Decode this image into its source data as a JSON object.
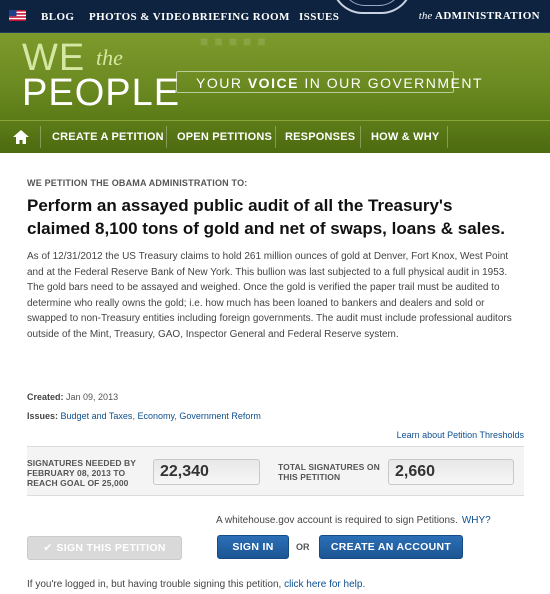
{
  "topnav": {
    "links": [
      "BLOG",
      "PHOTOS & VIDEO",
      "BRIEFING ROOM",
      "ISSUES"
    ],
    "admin_prefix": "the",
    "admin_label": "ADMINISTRATION"
  },
  "banner": {
    "logo_we": "WE",
    "logo_the": "the",
    "logo_people": "PEOPLE",
    "tagline_pre": "YOUR",
    "tagline_bold": "VOICE",
    "tagline_post": "IN OUR GOVERNMENT"
  },
  "subnav": {
    "items": [
      "CREATE A PETITION",
      "OPEN PETITIONS",
      "RESPONSES",
      "HOW & WHY"
    ]
  },
  "petition": {
    "kicker": "WE PETITION THE OBAMA ADMINISTRATION TO:",
    "title": "Perform an assayed public audit of all the Treasury's claimed 8,100 tons of gold and net of swaps, loans & sales.",
    "body": "As of 12/31/2012 the US Treasury claims to hold 261 million ounces of gold at Denver, Fort Knox, West Point and at the Federal Reserve Bank of New York. This bullion was last subjected to a full physical audit in 1953. The gold bars need to be assayed and weighed. Once the gold is verified the paper trail must be audited to determine who really owns the gold; i.e. how much has been loaned to bankers and dealers and sold or swapped to non-Treasury entities including foreign governments. The audit must include professional auditors outside of the Mint, Treasury, GAO, Inspector General and Federal Reserve system.",
    "created_label": "Created:",
    "created_value": "Jan 09, 2013",
    "issues_label": "Issues:",
    "issues": [
      "Budget and Taxes",
      "Economy",
      "Government Reform"
    ],
    "learn_link": "Learn about Petition Thresholds"
  },
  "signatures": {
    "needed_line1": "SIGNATURES NEEDED BY",
    "needed_line2": "FEBRUARY 08, 2013 TO",
    "needed_line3": "REACH GOAL OF 25,000",
    "needed_value": "22,340",
    "total_line1": "TOTAL SIGNATURES ON",
    "total_line2": "THIS PETITION",
    "total_value": "2,660"
  },
  "actions": {
    "account_required": "A whitehouse.gov account is required to sign Petitions.",
    "why": "WHY?",
    "sign_button": "SIGN THIS PETITION",
    "signin_button": "SIGN IN",
    "or": "OR",
    "create_button": "CREATE AN ACCOUNT",
    "help_text": "If you're logged in, but having trouble signing this petition,",
    "help_link": "click here for help."
  },
  "colors": {
    "nav_bg": "#0e2340",
    "banner_green": "#6b8a21",
    "subnav_green": "#4c6a0f",
    "button_blue": "#1c5594",
    "link_blue": "#0e4f8f"
  }
}
